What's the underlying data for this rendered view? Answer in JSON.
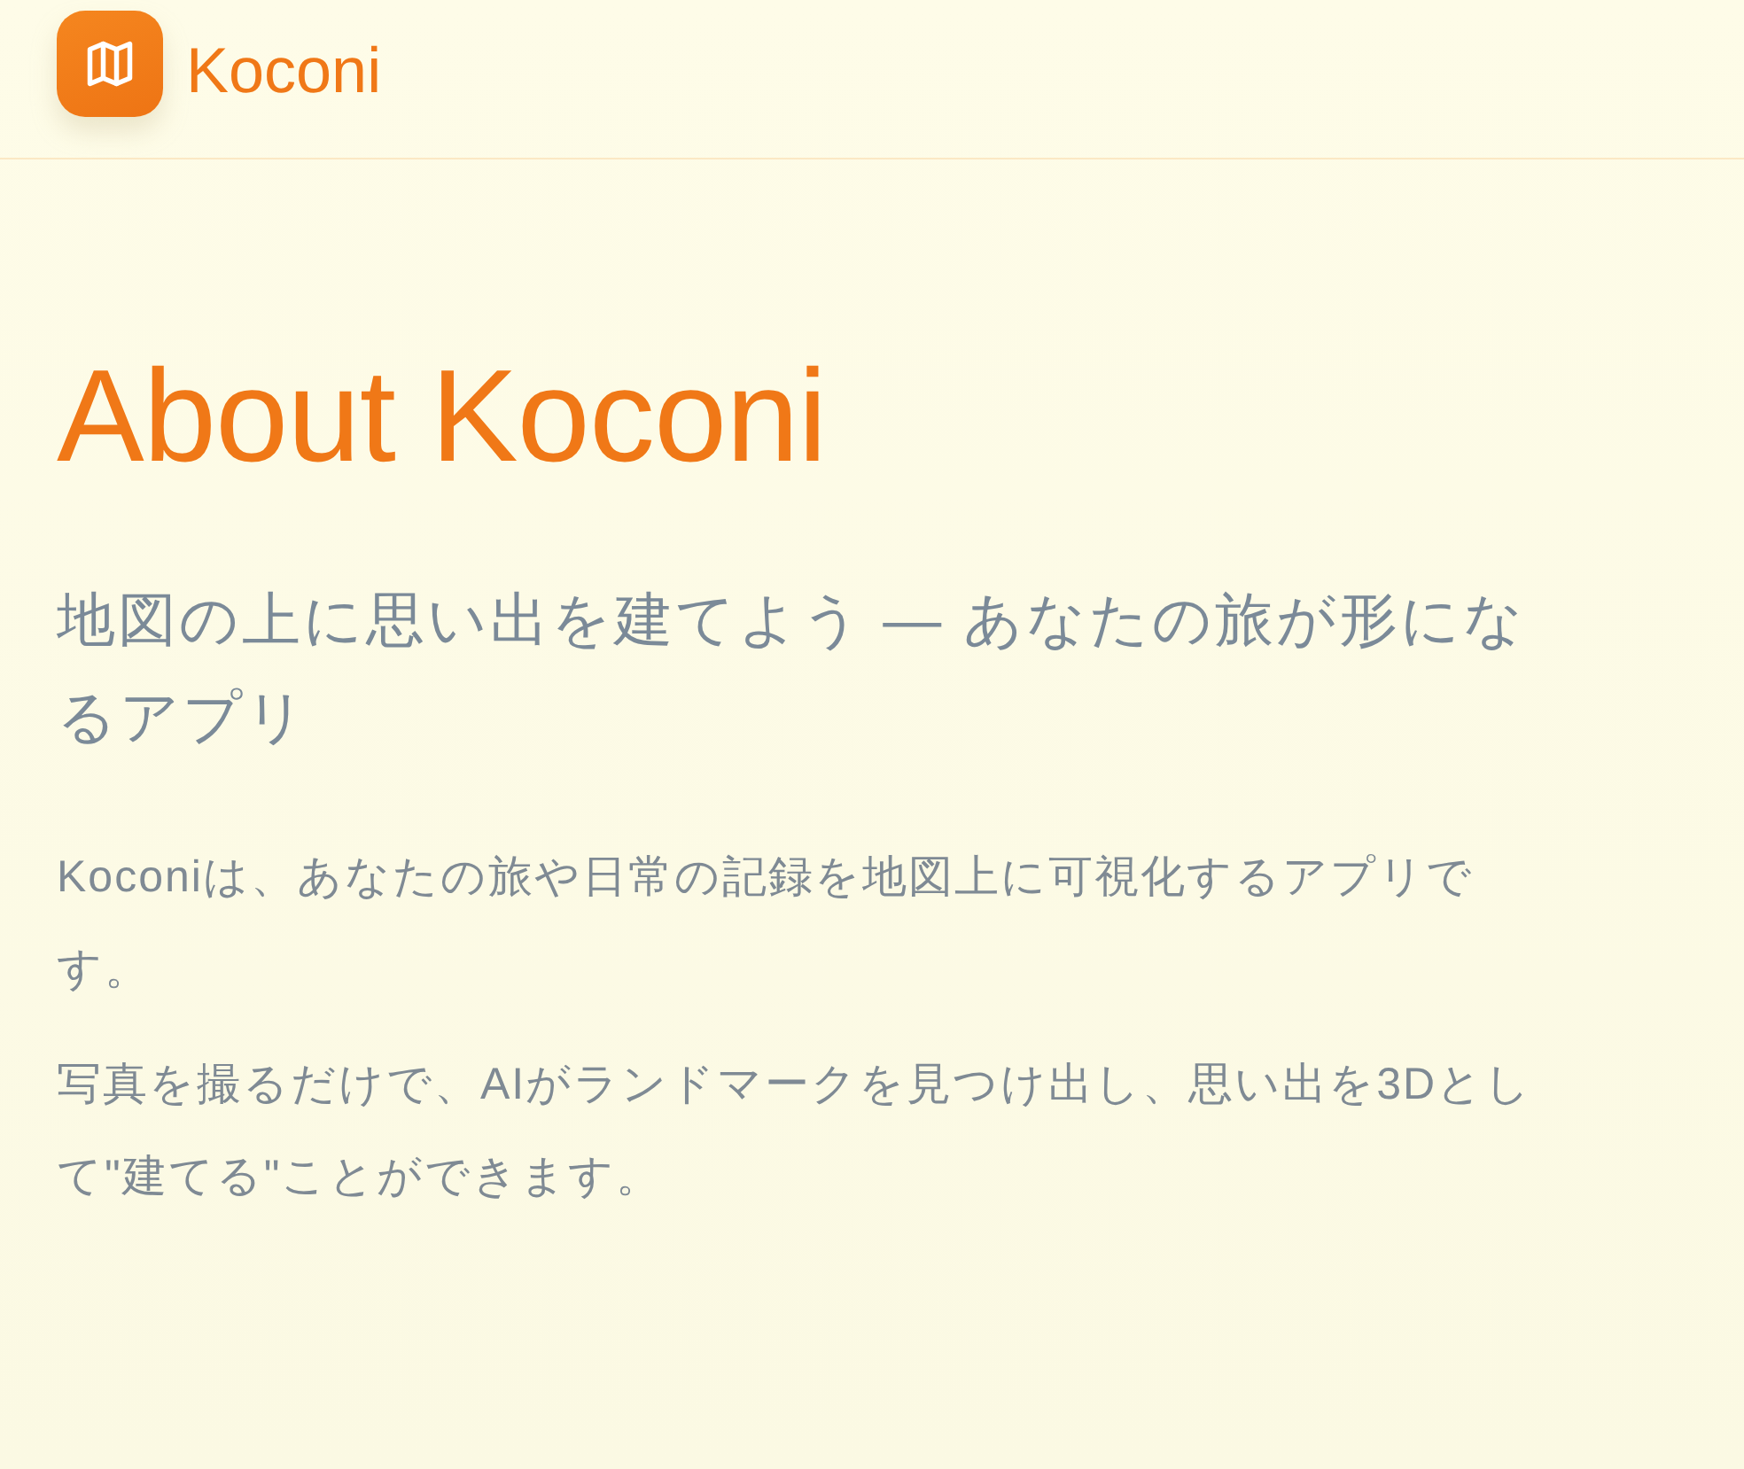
{
  "header": {
    "brand": {
      "text": "Koconi"
    }
  },
  "main": {
    "title": "About Koconi",
    "subtitle": "地図の上に思い出を建てよう — あなたの旅が形になるアプリ",
    "paragraphs": [
      "Koconiは、あなたの旅や日常の記録を地図上に可視化するアプリです。",
      "写真を撮るだけで、AIがランドマークを見つけ出し、思い出を3Dとして\"建てる\"ことができます。"
    ]
  }
}
